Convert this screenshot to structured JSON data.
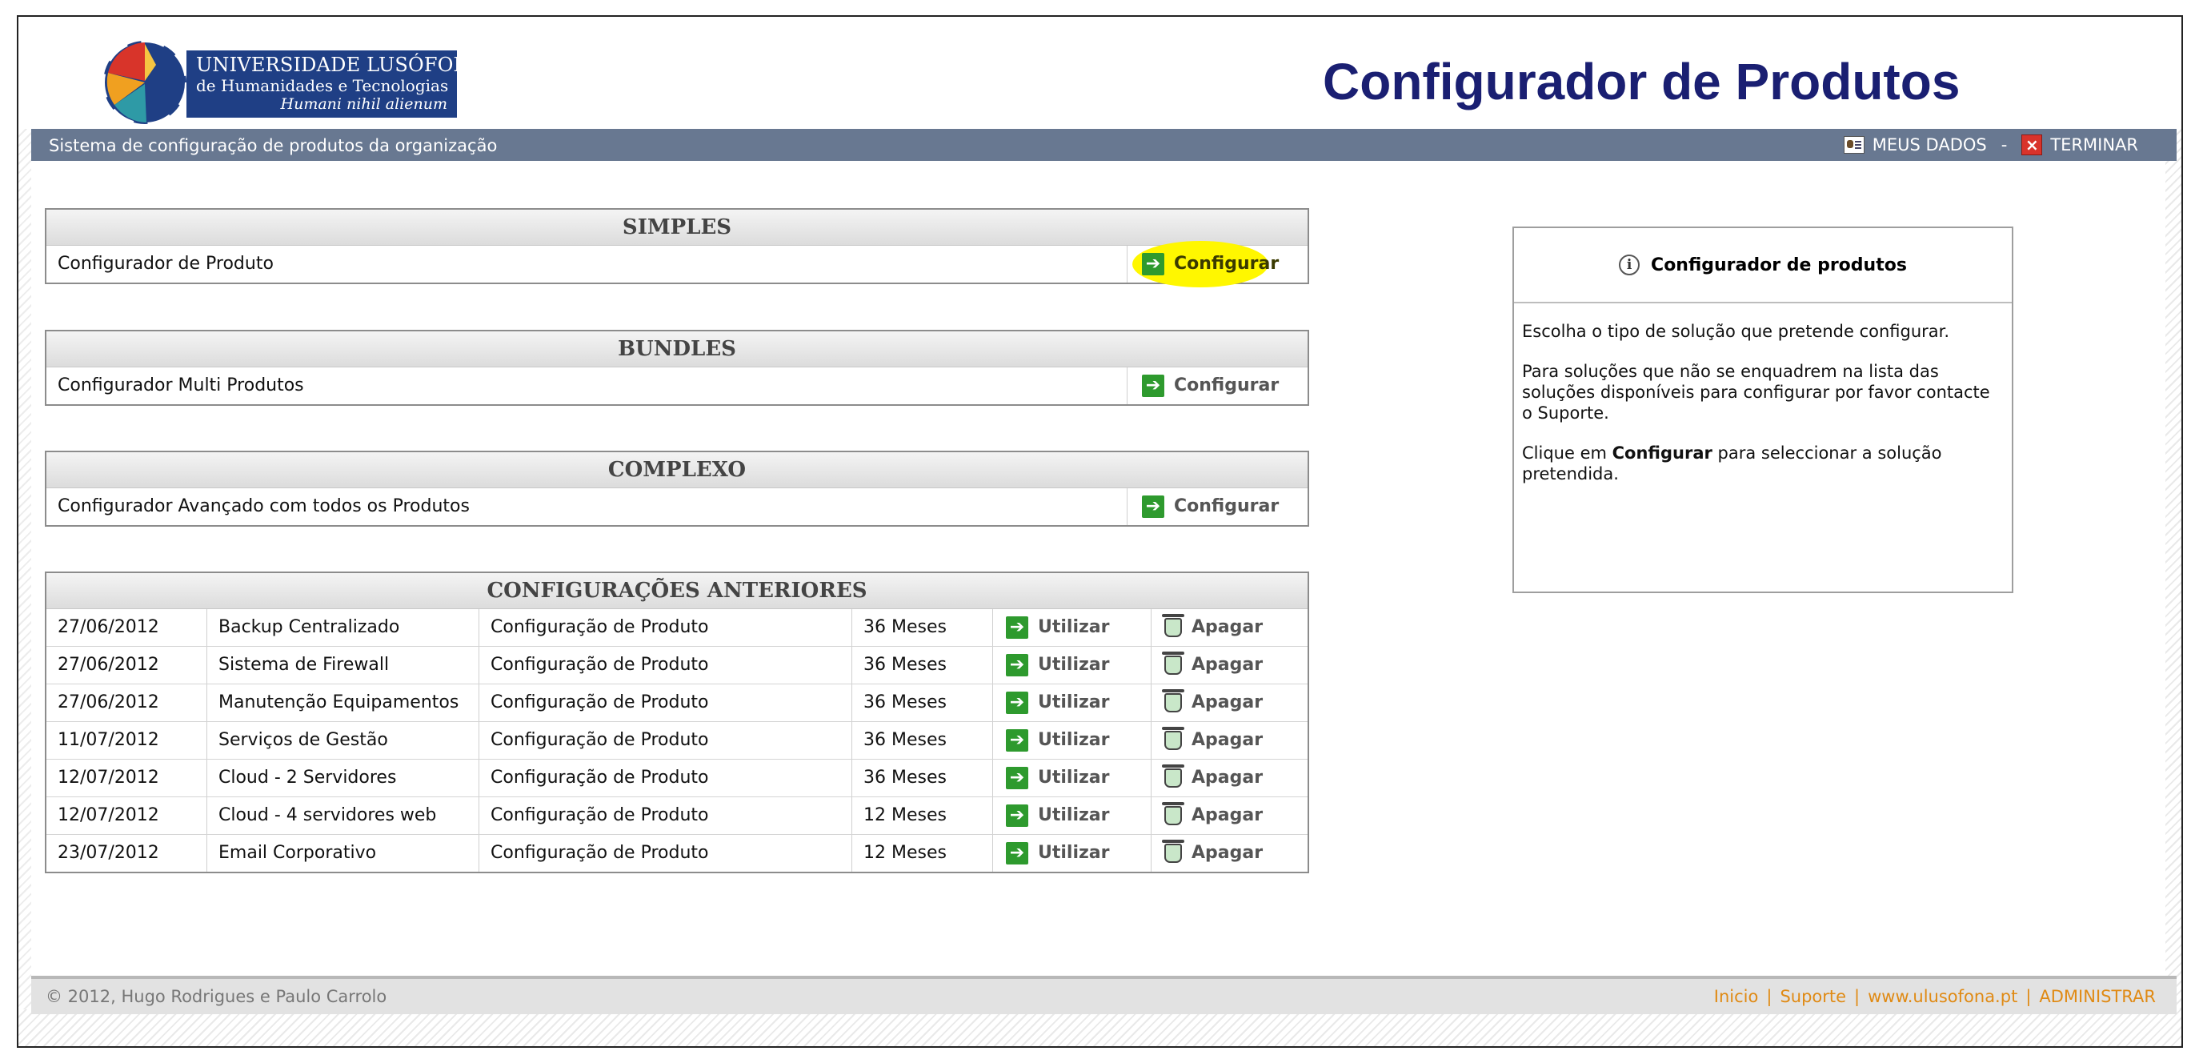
{
  "header": {
    "logo": {
      "line1": "UNIVERSIDADE LUSÓFONA",
      "line2": "de Humanidades e Tecnologias",
      "line3": "Humani nihil alienum"
    },
    "title": "Configurador de Produtos"
  },
  "topbar": {
    "subtitle": "Sistema de configuração de produtos da organização",
    "my_data": "MEUS DADOS",
    "separator": "-",
    "logout": "TERMINAR"
  },
  "panels": {
    "simples": {
      "title": "SIMPLES",
      "item": "Configurador de Produto",
      "action": "Configurar"
    },
    "bundles": {
      "title": "BUNDLES",
      "item": "Configurador Multi Produtos",
      "action": "Configurar"
    },
    "complexo": {
      "title": "COMPLEXO",
      "item": "Configurador Avançado com todos os Produtos",
      "action": "Configurar"
    }
  },
  "history": {
    "title": "CONFIGURAÇÕES ANTERIORES",
    "use_label": "Utilizar",
    "delete_label": "Apagar",
    "rows": [
      {
        "date": "27/06/2012",
        "name": "Backup Centralizado",
        "type": "Configuração de Produto",
        "term": "36 Meses"
      },
      {
        "date": "27/06/2012",
        "name": "Sistema de Firewall",
        "type": "Configuração de Produto",
        "term": "36 Meses"
      },
      {
        "date": "27/06/2012",
        "name": "Manutenção Equipamentos",
        "type": "Configuração de Produto",
        "term": "36 Meses"
      },
      {
        "date": "11/07/2012",
        "name": "Serviços de Gestão",
        "type": "Configuração de Produto",
        "term": "36 Meses"
      },
      {
        "date": "12/07/2012",
        "name": "Cloud - 2 Servidores",
        "type": "Configuração de Produto",
        "term": "36 Meses"
      },
      {
        "date": "12/07/2012",
        "name": "Cloud - 4 servidores web",
        "type": "Configuração de Produto",
        "term": "12 Meses"
      },
      {
        "date": "23/07/2012",
        "name": "Email Corporativo",
        "type": "Configuração de Produto",
        "term": "12 Meses"
      }
    ]
  },
  "info": {
    "title": "Configurador de produtos",
    "p1": "Escolha o tipo de solução que pretende configurar.",
    "p2": "Para soluções que não se enquadrem na lista das soluções disponíveis para configurar por favor contacte o Suporte.",
    "p3_pre": "Clique em ",
    "p3_bold": "Configurar",
    "p3_post": " para seleccionar a solução pretendida."
  },
  "footer": {
    "copyright": "© 2012, Hugo Rodrigues e Paulo Carrolo",
    "links": {
      "home": "Inicio",
      "support": "Suporte",
      "site": "www.ulusofona.pt",
      "admin": "ADMINISTRAR"
    },
    "separator": "|"
  },
  "colors": {
    "accent": "#1a1f72",
    "topbar": "#687891",
    "link": "#e08a14",
    "highlight": "#fff700",
    "action_icon": "#2e9a2e"
  }
}
